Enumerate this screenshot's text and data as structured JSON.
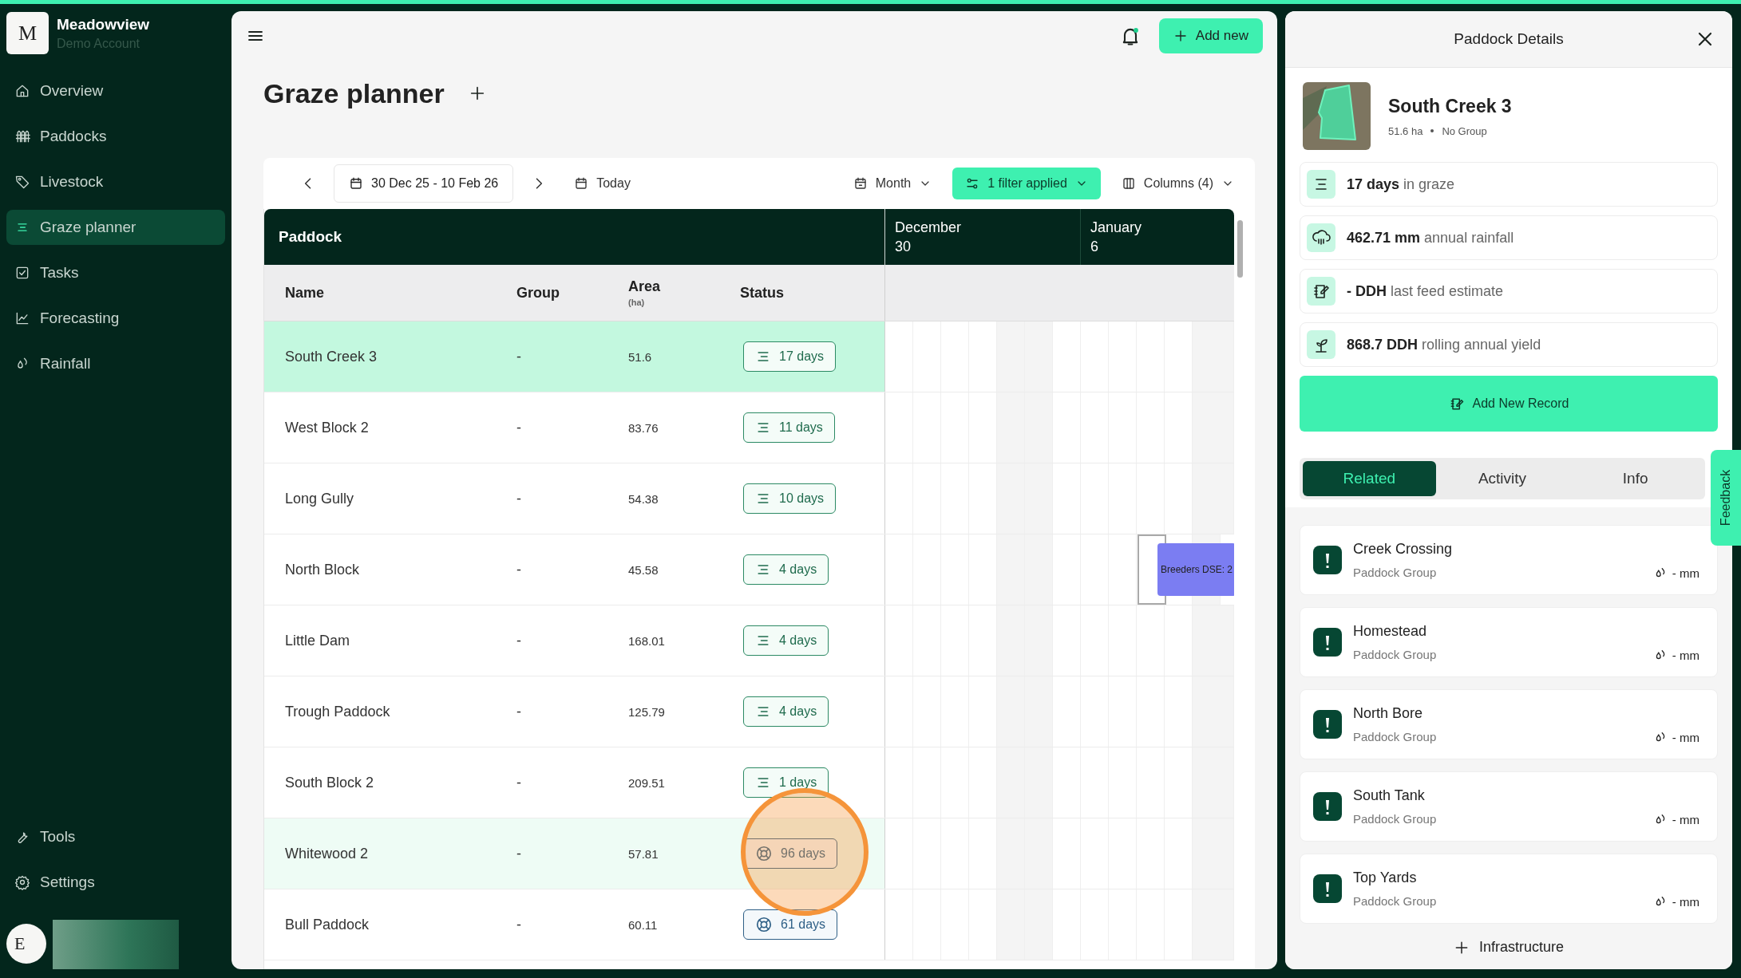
{
  "brand": {
    "initial": "M",
    "name": "Meadowview",
    "account": "Demo Account"
  },
  "nav": [
    {
      "label": "Overview",
      "selected": false
    },
    {
      "label": "Paddocks",
      "selected": false
    },
    {
      "label": "Livestock",
      "selected": false
    },
    {
      "label": "Graze planner",
      "selected": true
    },
    {
      "label": "Tasks",
      "selected": false
    },
    {
      "label": "Forecasting",
      "selected": false
    },
    {
      "label": "Rainfall",
      "selected": false
    }
  ],
  "nav_bottom": [
    {
      "label": "Tools",
      "selected": false
    },
    {
      "label": "Settings",
      "selected": false
    }
  ],
  "user": {
    "initial": "E"
  },
  "topbar": {
    "add_button": "Add new"
  },
  "page": {
    "title": "Graze planner"
  },
  "toolbar": {
    "date_range": "30 Dec 25 - 10 Feb 26",
    "today": "Today",
    "view": "Month",
    "filter": "1 filter applied",
    "columns": "Columns (4)"
  },
  "table": {
    "group_heading": "Paddock",
    "columns": [
      {
        "label": "Name"
      },
      {
        "label": "Group"
      },
      {
        "label": "Area",
        "unit": "(ha)"
      },
      {
        "label": "Status"
      }
    ],
    "months": [
      {
        "month": "December",
        "day": "30"
      },
      {
        "month": "January",
        "day": "6"
      }
    ],
    "rows": [
      {
        "name": "South Creek 3",
        "group": "-",
        "area": "51.6",
        "status": {
          "kind": "grazing",
          "text": "17 days"
        },
        "selected": true,
        "hovered": false,
        "click_marker": false
      },
      {
        "name": "West Block 2",
        "group": "-",
        "area": "83.76",
        "status": {
          "kind": "grazing",
          "text": "11 days"
        },
        "selected": false,
        "hovered": false,
        "click_marker": false
      },
      {
        "name": "Long Gully",
        "group": "-",
        "area": "54.38",
        "status": {
          "kind": "grazing",
          "text": "10 days"
        },
        "selected": false,
        "hovered": false,
        "click_marker": false
      },
      {
        "name": "North Block",
        "group": "-",
        "area": "45.58",
        "status": {
          "kind": "grazing",
          "text": "4 days"
        },
        "selected": false,
        "hovered": false,
        "click_marker": false,
        "event": {
          "label": "Breeders DSE: 2"
        }
      },
      {
        "name": "Little Dam",
        "group": "-",
        "area": "168.01",
        "status": {
          "kind": "grazing",
          "text": "4 days"
        },
        "selected": false,
        "hovered": false,
        "click_marker": false
      },
      {
        "name": "Trough Paddock",
        "group": "-",
        "area": "125.79",
        "status": {
          "kind": "grazing",
          "text": "4 days"
        },
        "selected": false,
        "hovered": false,
        "click_marker": false
      },
      {
        "name": "South Block 2",
        "group": "-",
        "area": "209.51",
        "status": {
          "kind": "grazing",
          "text": "1 days"
        },
        "selected": false,
        "hovered": false,
        "click_marker": false
      },
      {
        "name": "Whitewood 2",
        "group": "-",
        "area": "57.81",
        "status": {
          "kind": "resting",
          "text": "96 days"
        },
        "selected": false,
        "hovered": true,
        "click_marker": true
      },
      {
        "name": "Bull Paddock",
        "group": "-",
        "area": "60.11",
        "status": {
          "kind": "resting",
          "text": "61 days"
        },
        "selected": false,
        "hovered": false,
        "click_marker": false
      }
    ]
  },
  "details": {
    "title": "Paddock Details",
    "name": "South Creek 3",
    "area": "51.6 ha",
    "group": "No Group",
    "stats": [
      {
        "value": "17 days",
        "label": "in graze"
      },
      {
        "value": "462.71 mm",
        "label": "annual rainfall"
      },
      {
        "value": "- DDH",
        "label": "last feed estimate"
      },
      {
        "value": "868.7 DDH",
        "label": "rolling annual yield"
      }
    ],
    "add_record": "Add New Record",
    "tabs": [
      {
        "label": "Related",
        "selected": true
      },
      {
        "label": "Activity",
        "selected": false
      },
      {
        "label": "Info",
        "selected": false
      }
    ],
    "related": [
      {
        "name": "Creek Crossing",
        "type": "Paddock Group",
        "rainfall": "- mm"
      },
      {
        "name": "Homestead",
        "type": "Paddock Group",
        "rainfall": "- mm"
      },
      {
        "name": "North Bore",
        "type": "Paddock Group",
        "rainfall": "- mm"
      },
      {
        "name": "South Tank",
        "type": "Paddock Group",
        "rainfall": "- mm"
      },
      {
        "name": "Top Yards",
        "type": "Paddock Group",
        "rainfall": "- mm"
      }
    ],
    "add_infrastructure": "Infrastructure"
  },
  "feedback": "Feedback"
}
